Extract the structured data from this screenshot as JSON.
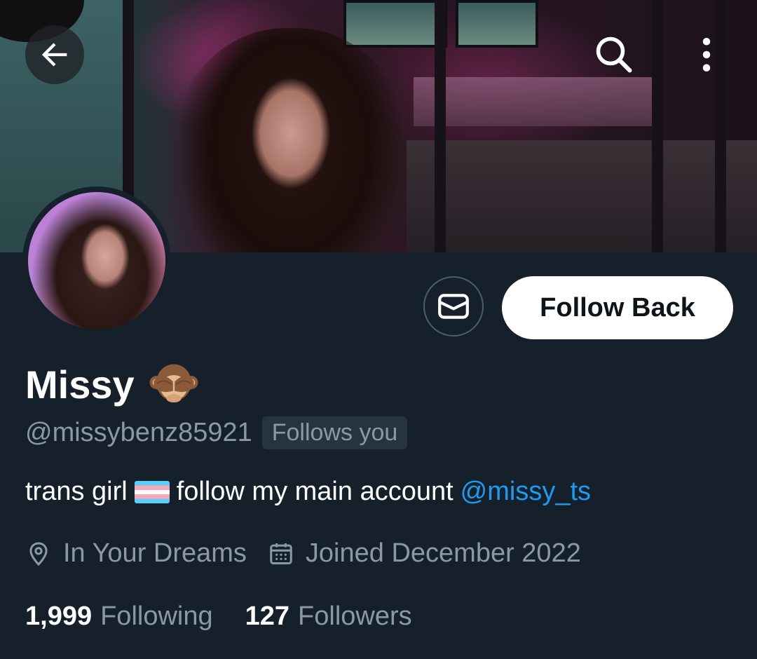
{
  "header": {
    "back_icon": "arrow-left-icon",
    "search_icon": "search-icon",
    "more_icon": "more-vertical-icon"
  },
  "actions": {
    "message_icon": "envelope-icon",
    "follow_label": "Follow Back"
  },
  "profile": {
    "display_name": "Missy",
    "name_emoji": "see-no-evil-monkey-icon",
    "handle": "@missybenz85921",
    "follows_you": "Follows you",
    "bio_text": "trans girl",
    "bio_flag": "transgender-flag-icon",
    "bio_text_2": "follow my main account",
    "bio_mention": "@missy_ts",
    "location": "In Your Dreams",
    "joined": "Joined December 2022"
  },
  "stats": {
    "following_count": "1,999",
    "following_label": "Following",
    "followers_count": "127",
    "followers_label": "Followers"
  },
  "colors": {
    "background": "#15202b",
    "secondary_text": "#8b98a5",
    "link": "#1d9bf0",
    "button_bg": "#ffffff",
    "button_text": "#0f1419"
  }
}
